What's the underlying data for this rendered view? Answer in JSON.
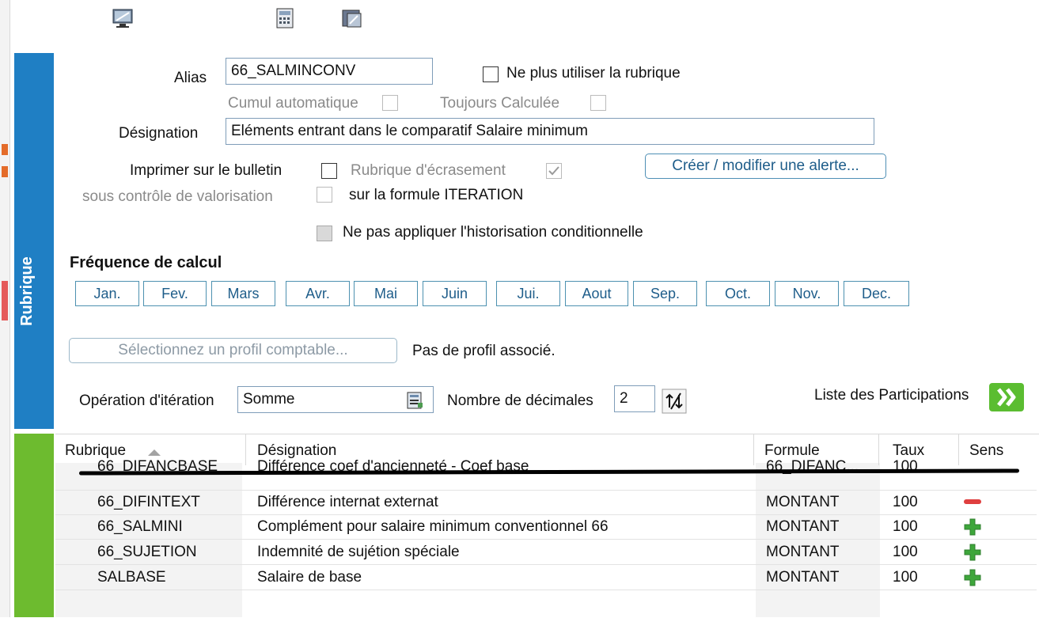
{
  "app": {
    "side_label": "Rubrique"
  },
  "form": {
    "alias_label": "Alias",
    "alias_value": "66_SALMINCONV",
    "ne_plus_utiliser_label": "Ne plus utiliser la rubrique",
    "cumul_auto_label": "Cumul automatique",
    "toujours_calculee_label": "Toujours Calculée",
    "designation_label": "Désignation",
    "designation_value": "Eléments entrant dans le comparatif Salaire minimum",
    "imprimer_label": "Imprimer sur le bulletin",
    "sous_controle_label": "sous contrôle de valorisation",
    "rubrique_ecrasement_label": "Rubrique d'écrasement",
    "iteration_formula_label": "sur la formule ITERATION",
    "creer_alerte_label": "Créer / modifier une alerte...",
    "historisation_label": "Ne pas appliquer l'historisation conditionnelle",
    "frequence_label": "Fréquence de calcul",
    "months": [
      "Jan.",
      "Fev.",
      "Mars",
      "Avr.",
      "Mai",
      "Juin",
      "Jui.",
      "Aout",
      "Sep.",
      "Oct.",
      "Nov.",
      "Dec."
    ],
    "profil_placeholder": "Sélectionnez un profil comptable...",
    "profil_status": "Pas de profil associé.",
    "operation_label": "Opération d'itération",
    "operation_value": "Somme",
    "decimales_label": "Nombre de décimales",
    "decimales_value": "2",
    "participations_label": "Liste des Participations"
  },
  "table": {
    "headers": [
      "Rubrique",
      "Désignation",
      "Formule",
      "Taux",
      "Sens"
    ],
    "rows": [
      {
        "rubrique": "66_DIFANCBASE",
        "designation": "Différence coef d'ancienneté - Coef base",
        "formule": "66_DIFANC...",
        "taux": "100",
        "sens": ""
      },
      {
        "rubrique": "66_DIFINTEXT",
        "designation": "Différence internat externat",
        "formule": "MONTANT",
        "taux": "100",
        "sens": "minus"
      },
      {
        "rubrique": "66_SALMINI",
        "designation": "Complément pour salaire minimum conventionnel 66",
        "formule": "MONTANT",
        "taux": "100",
        "sens": "plus"
      },
      {
        "rubrique": "66_SUJETION",
        "designation": "Indemnité de sujétion spéciale",
        "formule": "MONTANT",
        "taux": "100",
        "sens": "plus"
      },
      {
        "rubrique": "SALBASE",
        "designation": "Salaire de base",
        "formule": "MONTANT",
        "taux": "100",
        "sens": "plus"
      }
    ]
  },
  "colors": {
    "blue_tab": "#1f7fc4",
    "green_tab": "#6dbb2f",
    "accent_button": "#1e5d8a"
  }
}
